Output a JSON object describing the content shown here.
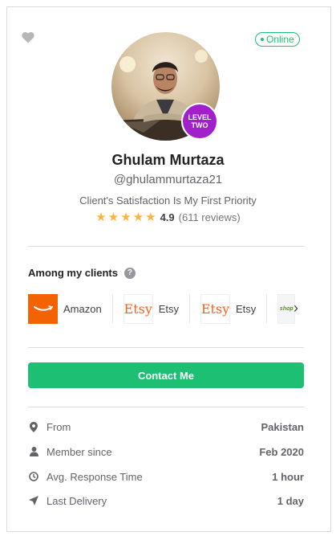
{
  "profile": {
    "status": "Online",
    "level_line1": "LEVEL",
    "level_line2": "TWO",
    "name": "Ghulam Murtaza",
    "handle": "@ghulammurtaza21",
    "tagline": "Client's Satisfaction Is My First Priority",
    "rating_score": "4.9",
    "rating_reviews": "(611 reviews)",
    "stars": 5
  },
  "clients": {
    "title": "Among my clients",
    "help_glyph": "?",
    "items": [
      {
        "label": "Amazon",
        "icon": "amazon-logo"
      },
      {
        "label": "Etsy",
        "icon": "etsy-logo",
        "logo_text": "Etsy"
      },
      {
        "label": "Etsy",
        "icon": "etsy-logo",
        "logo_text": "Etsy"
      },
      {
        "label": "",
        "icon": "shopify-logo",
        "logo_text": "shop"
      }
    ]
  },
  "contact_button": "Contact Me",
  "stats": [
    {
      "icon": "location-pin-icon",
      "label": "From",
      "value": "Pakistan"
    },
    {
      "icon": "user-icon",
      "label": "Member since",
      "value": "Feb 2020"
    },
    {
      "icon": "clock-icon",
      "label": "Avg. Response Time",
      "value": "1 hour"
    },
    {
      "icon": "send-icon",
      "label": "Last Delivery",
      "value": "1 day"
    }
  ],
  "colors": {
    "accent": "#1dbf73",
    "level_badge": "#a31fcc",
    "star": "#ffb33e"
  }
}
